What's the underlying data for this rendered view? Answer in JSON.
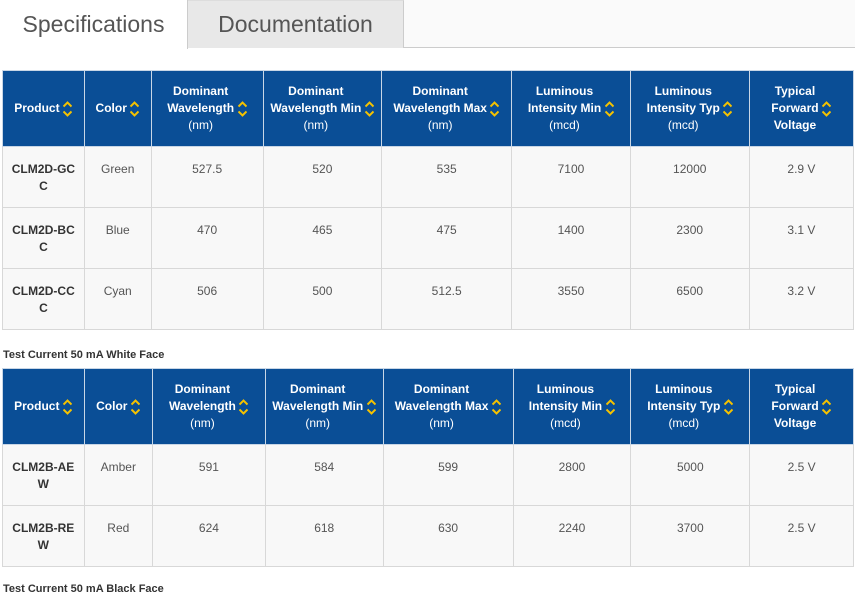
{
  "tabs": [
    {
      "label": "Specifications",
      "active": true
    },
    {
      "label": "Documentation",
      "active": false
    }
  ],
  "colors": {
    "header_bg": "#0a4e96",
    "sort_arrow": "#f5c200",
    "cell_bg": "#f8f8f8"
  },
  "columns": [
    {
      "lines": [
        "Product"
      ],
      "unit": ""
    },
    {
      "lines": [
        "Color"
      ],
      "unit": ""
    },
    {
      "lines": [
        "Dominant",
        "Wavelength"
      ],
      "unit": "(nm)"
    },
    {
      "lines": [
        "Dominant",
        "Wavelength Min"
      ],
      "unit": "(nm)"
    },
    {
      "lines": [
        "Dominant",
        "Wavelength Max"
      ],
      "unit": "(nm)"
    },
    {
      "lines": [
        "Luminous",
        "Intensity Min"
      ],
      "unit": "(mcd)"
    },
    {
      "lines": [
        "Luminous",
        "Intensity Typ"
      ],
      "unit": "(mcd)"
    },
    {
      "lines": [
        "Typical",
        "Forward",
        "Voltage"
      ],
      "unit": ""
    }
  ],
  "table1": {
    "rows": [
      [
        "CLM2D-GCC",
        "Green",
        "527.5",
        "520",
        "535",
        "7100",
        "12000",
        "2.9 V"
      ],
      [
        "CLM2D-BCC",
        "Blue",
        "470",
        "465",
        "475",
        "1400",
        "2300",
        "3.1 V"
      ],
      [
        "CLM2D-CCC",
        "Cyan",
        "506",
        "500",
        "512.5",
        "3550",
        "6500",
        "3.2 V"
      ]
    ]
  },
  "table2": {
    "title": "Test Current 50 mA White Face",
    "rows": [
      [
        "CLM2B-AEW",
        "Amber",
        "591",
        "584",
        "599",
        "2800",
        "5000",
        "2.5 V"
      ],
      [
        "CLM2B-REW",
        "Red",
        "624",
        "618",
        "630",
        "2240",
        "3700",
        "2.5 V"
      ]
    ]
  },
  "table3": {
    "title": "Test Current 50 mA Black Face"
  }
}
